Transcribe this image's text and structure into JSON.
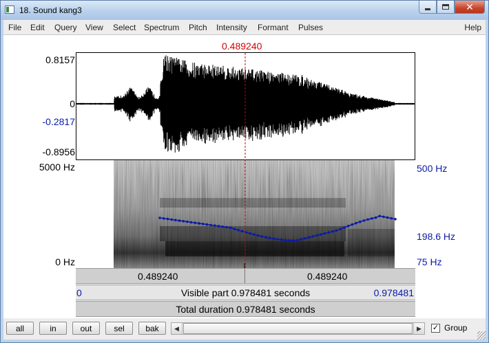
{
  "window": {
    "title": "18. Sound kang3"
  },
  "menu": [
    "File",
    "Edit",
    "Query",
    "View",
    "Select",
    "Spectrum",
    "Pitch",
    "Intensity",
    "Formant",
    "Pulses"
  ],
  "menu_help": "Help",
  "cursor": {
    "time_label": "0.489240",
    "time": 0.48924
  },
  "waveform": {
    "top": "0.8157",
    "zero": "0",
    "cursor_value": "-0.2817",
    "bottom": "-0.8956"
  },
  "spectrogram": {
    "top": "5000 Hz",
    "bottom": "0 Hz"
  },
  "pitch_scale": {
    "top": "500 Hz",
    "current": "198.6 Hz",
    "bottom": "75 Hz"
  },
  "bars": {
    "left_segment": "0.489240",
    "right_segment": "0.489240",
    "visible_start": "0",
    "visible_label": "Visible part 0.978481 seconds",
    "visible_end": "0.978481",
    "total_label": "Total duration 0.978481 seconds"
  },
  "buttons": {
    "all": "all",
    "in": "in",
    "out": "out",
    "sel": "sel",
    "bak": "bak"
  },
  "group": {
    "label": "Group",
    "checked": true,
    "mark": "✓"
  },
  "colors": {
    "cursor": "#d00000",
    "pitch": "#0b1aa8",
    "waveform": "#000000"
  }
}
